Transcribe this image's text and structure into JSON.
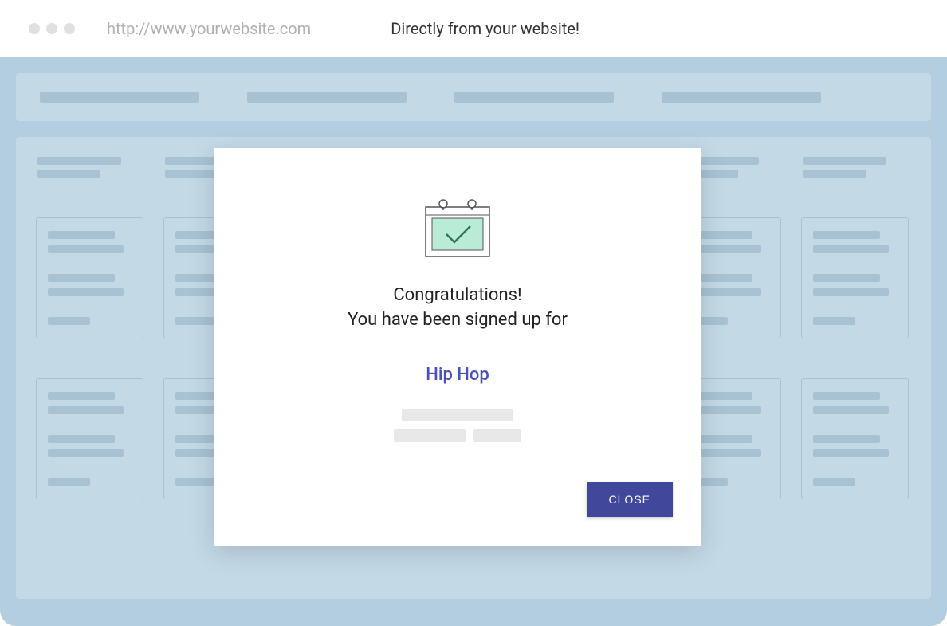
{
  "chrome": {
    "url": "http://www.yourwebsite.com",
    "tagline": "Directly from your website!"
  },
  "modal": {
    "line1": "Congratulations!",
    "line2": "You have been signed up for",
    "course": "Hip Hop",
    "close_label": "CLOSE"
  },
  "colors": {
    "accent": "#41479b",
    "link": "#4a4fc4",
    "page_bg": "#b2cee0"
  }
}
